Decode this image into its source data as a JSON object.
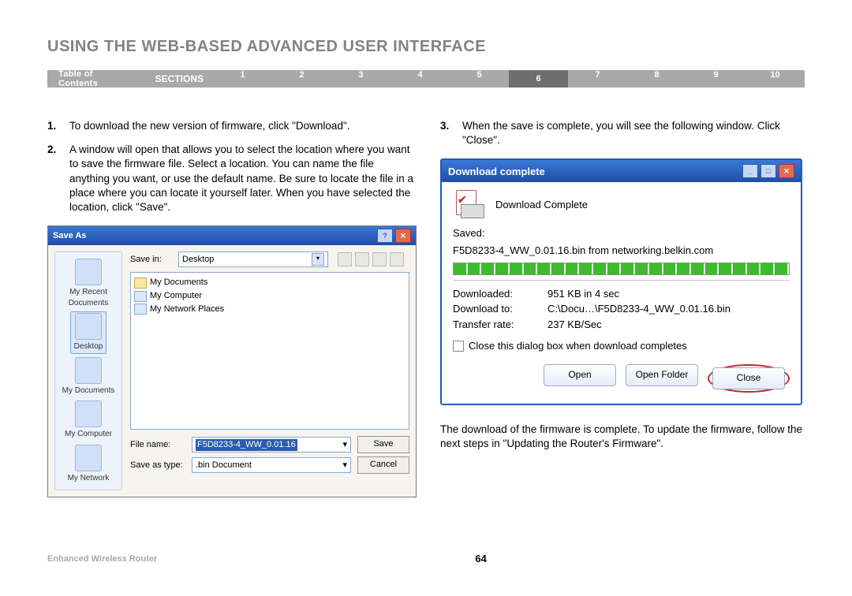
{
  "title": "USING THE WEB-BASED ADVANCED USER INTERFACE",
  "nav": {
    "toc": "Table of Contents",
    "sections_label": "SECTIONS",
    "sections": [
      "1",
      "2",
      "3",
      "4",
      "5",
      "6",
      "7",
      "8",
      "9",
      "10"
    ],
    "active": "6"
  },
  "left": {
    "step1": {
      "num": "1.",
      "text": "To download the new version of firmware, click \"Download\"."
    },
    "step2": {
      "num": "2.",
      "text": "A window will open that allows you to select the location where you want to save the firmware file. Select a location. You can name the file anything you want, or use the default name. Be sure to locate the file in a place where you can locate it yourself later. When you have selected the location, click \"Save\"."
    },
    "saveas": {
      "title": "Save As",
      "savein_label": "Save in:",
      "savein_value": "Desktop",
      "list": [
        "My Documents",
        "My Computer",
        "My Network Places"
      ],
      "sidebar": [
        "My Recent Documents",
        "Desktop",
        "My Documents",
        "My Computer",
        "My Network"
      ],
      "filename_label": "File name:",
      "filename_value": "F5D8233-4_WW_0.01.16",
      "saveastype_label": "Save as type:",
      "saveastype_value": ".bin Document",
      "save_btn": "Save",
      "cancel_btn": "Cancel"
    }
  },
  "right": {
    "step3": {
      "num": "3.",
      "text": "When the save is complete, you will see the following window. Click \"Close\"."
    },
    "dlc": {
      "title": "Download complete",
      "head": "Download Complete",
      "saved_label": "Saved:",
      "saved_value": "F5D8233-4_WW_0.01.16.bin from networking.belkin.com",
      "downloaded_label": "Downloaded:",
      "downloaded_value": "951 KB in 4 sec",
      "downloadto_label": "Download to:",
      "downloadto_value": "C:\\Docu…\\F5D8233-4_WW_0.01.16.bin",
      "rate_label": "Transfer rate:",
      "rate_value": "237 KB/Sec",
      "checkbox": "Close this dialog box when download completes",
      "open_btn": "Open",
      "openfolder_btn": "Open Folder",
      "close_btn": "Close"
    },
    "followup": "The download of the firmware is complete. To update the firmware, follow the next steps in \"Updating the Router's Firmware\"."
  },
  "footer": {
    "product": "Enhanced Wireless Router",
    "page": "64"
  }
}
